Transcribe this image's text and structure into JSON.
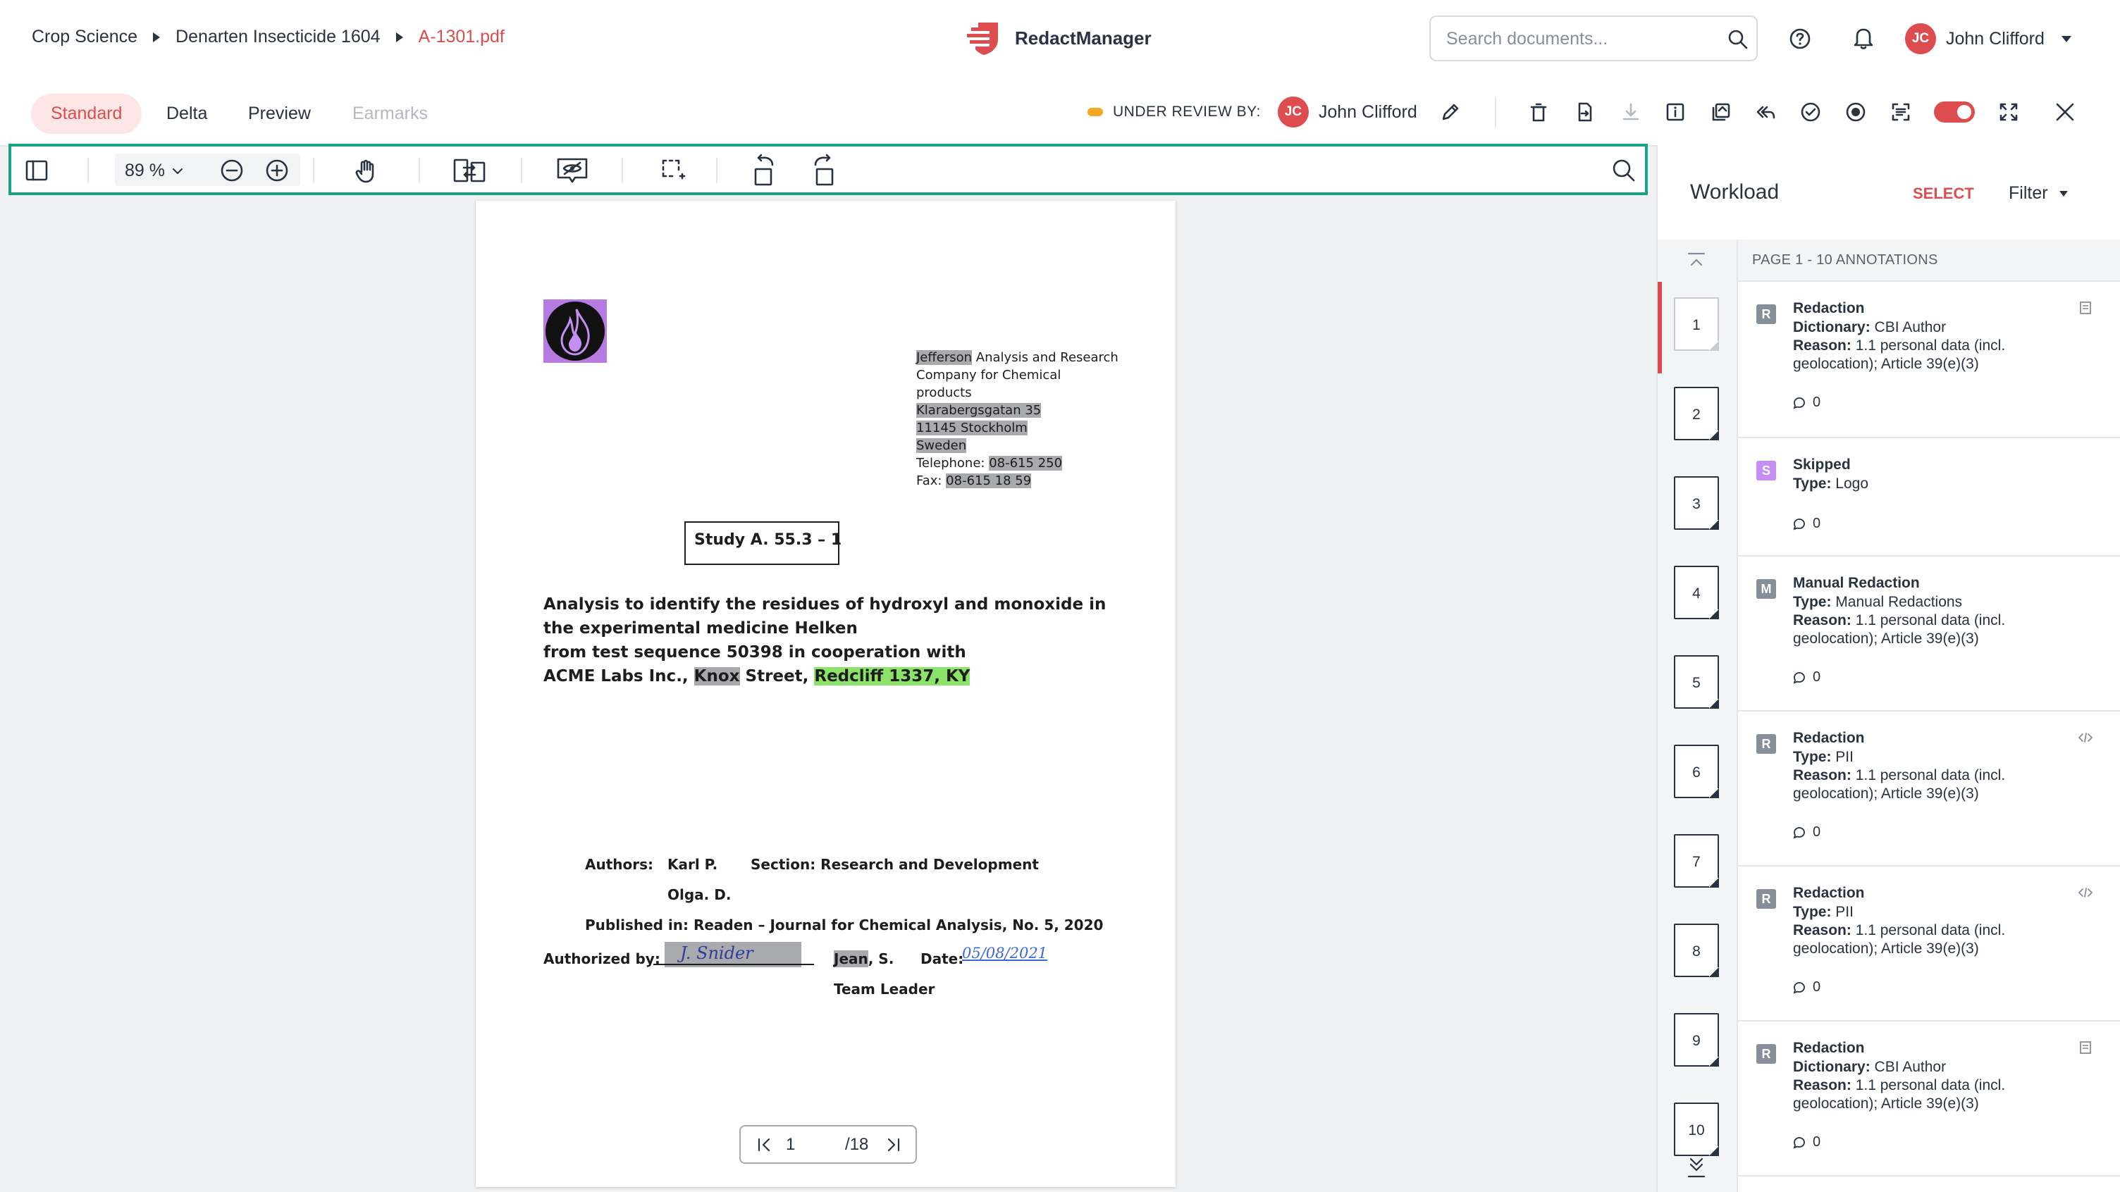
{
  "header": {
    "breadcrumb": [
      "Crop Science",
      "Denarten Insecticide 1604",
      "A-1301.pdf"
    ],
    "app_name": "RedactManager",
    "search_placeholder": "Search documents...",
    "user": {
      "initials": "JC",
      "name": "John Clifford"
    }
  },
  "view_tabs": [
    "Standard",
    "Delta",
    "Preview",
    "Earmarks"
  ],
  "review": {
    "label": "UNDER REVIEW BY:",
    "initials": "JC",
    "name": "John Clifford"
  },
  "viewer_toolbar": {
    "zoom": "89 %"
  },
  "document": {
    "address_lines": [
      {
        "parts": [
          [
            "Jefferson",
            "gray"
          ],
          [
            " Analysis and Research",
            ""
          ]
        ]
      },
      {
        "parts": [
          [
            "Company for Chemical",
            ""
          ]
        ]
      },
      {
        "parts": [
          [
            "products",
            ""
          ]
        ]
      },
      {
        "parts": [
          [
            "Klarabergsgatan 35",
            "gray"
          ]
        ]
      },
      {
        "parts": [
          [
            "11145 Stockholm",
            "gray"
          ]
        ]
      },
      {
        "parts": [
          [
            "Sweden",
            "gray"
          ]
        ]
      },
      {
        "parts": [
          [
            "Telephone: ",
            ""
          ],
          [
            "08-615 250",
            "gray"
          ]
        ]
      },
      {
        "parts": [
          [
            "Fax: ",
            ""
          ],
          [
            "08-615 18 59",
            "gray"
          ]
        ]
      }
    ],
    "study_box": "Study A. 55.3 – 1",
    "title_lines": [
      "Analysis to identify the residues of hydroxyl and monoxide in",
      "the experimental medicine Helken",
      "from test sequence 50398 in cooperation with"
    ],
    "title_last": {
      "prefix": "ACME Labs Inc., ",
      "name": "Knox",
      "middle": " Street, ",
      "place": "Redcliff 1337, KY"
    },
    "authors_label": "Authors:",
    "author1": "Karl P.",
    "author2": "Olga. D.",
    "section": "Section: Research and Development",
    "published": "Published in: Readen – Journal for Chemical Analysis, No. 5, 2020",
    "authorized_label": "Authorized by:",
    "signature": "J. Snider",
    "signer_name": "Jean",
    "signer_suffix": ", S.",
    "date_label": "Date:",
    "date_value": "05/08/2021",
    "team_leader": "Team Leader"
  },
  "pager": {
    "current": "1",
    "total": "/18"
  },
  "workload": {
    "title": "Workload",
    "select": "SELECT",
    "filter": "Filter",
    "pages_header": "PAGE 1 - 10 ANNOTATIONS",
    "page_numbers": [
      "1",
      "2",
      "3",
      "4",
      "5",
      "6",
      "7",
      "8",
      "9",
      "10"
    ],
    "annotations": [
      {
        "badge": "R",
        "color": "#868e9a",
        "title": "Redaction",
        "lines": [
          [
            "Dictionary:",
            " CBI Author"
          ],
          [
            "Reason:",
            " 1.1 personal data (incl."
          ],
          [
            "",
            "geolocation); Article 39(e)(3)"
          ]
        ],
        "comments": "0",
        "side_icon": "doc"
      },
      {
        "badge": "S",
        "color": "#c48ef2",
        "title": "Skipped",
        "lines": [
          [
            "Type:",
            " Logo"
          ]
        ],
        "comments": "0",
        "side_icon": ""
      },
      {
        "badge": "M",
        "color": "#868e9a",
        "title": "Manual Redaction",
        "lines": [
          [
            "Type:",
            " Manual Redactions"
          ],
          [
            "Reason:",
            " 1.1 personal data (incl."
          ],
          [
            "",
            "geolocation); Article 39(e)(3)"
          ]
        ],
        "comments": "0",
        "side_icon": ""
      },
      {
        "badge": "R",
        "color": "#868e9a",
        "title": "Redaction",
        "lines": [
          [
            "Type:",
            " PII"
          ],
          [
            "Reason:",
            " 1.1 personal data (incl."
          ],
          [
            "",
            "geolocation); Article 39(e)(3)"
          ]
        ],
        "comments": "0",
        "side_icon": "code"
      },
      {
        "badge": "R",
        "color": "#868e9a",
        "title": "Redaction",
        "lines": [
          [
            "Type:",
            " PII"
          ],
          [
            "Reason:",
            " 1.1 personal data (incl."
          ],
          [
            "",
            "geolocation); Article 39(e)(3)"
          ]
        ],
        "comments": "0",
        "side_icon": "code"
      },
      {
        "badge": "R",
        "color": "#868e9a",
        "title": "Redaction",
        "lines": [
          [
            "Dictionary:",
            " CBI Author"
          ],
          [
            "Reason:",
            " 1.1 personal data (incl."
          ],
          [
            "",
            "geolocation); Article 39(e)(3)"
          ]
        ],
        "comments": "0",
        "side_icon": "doc"
      }
    ]
  },
  "colors": {
    "accent": "#dd4d50",
    "focus_outline": "#1aa282",
    "redaction_gray": "#a9aaad",
    "highlight_green": "#8be36a",
    "review_dot": "#f5a623"
  },
  "icons": [
    "logo-icon",
    "search-icon",
    "help-icon",
    "bell-icon",
    "edit-icon",
    "trash-icon",
    "export-icon",
    "download-icon",
    "info-icon",
    "copy-icon",
    "reply-all-icon",
    "check-circle-icon",
    "record-icon",
    "scan-icon",
    "fullscreen-icon",
    "close-icon",
    "sidebar-toggle-icon",
    "zoom-out-icon",
    "zoom-in-icon",
    "pan-hand-icon",
    "compare-icon",
    "hide-redactions-icon",
    "select-area-icon",
    "rotate-left-icon",
    "rotate-right-icon",
    "first-page-icon",
    "last-page-icon",
    "collapse-up-icon",
    "expand-down-icon",
    "comment-icon"
  ]
}
